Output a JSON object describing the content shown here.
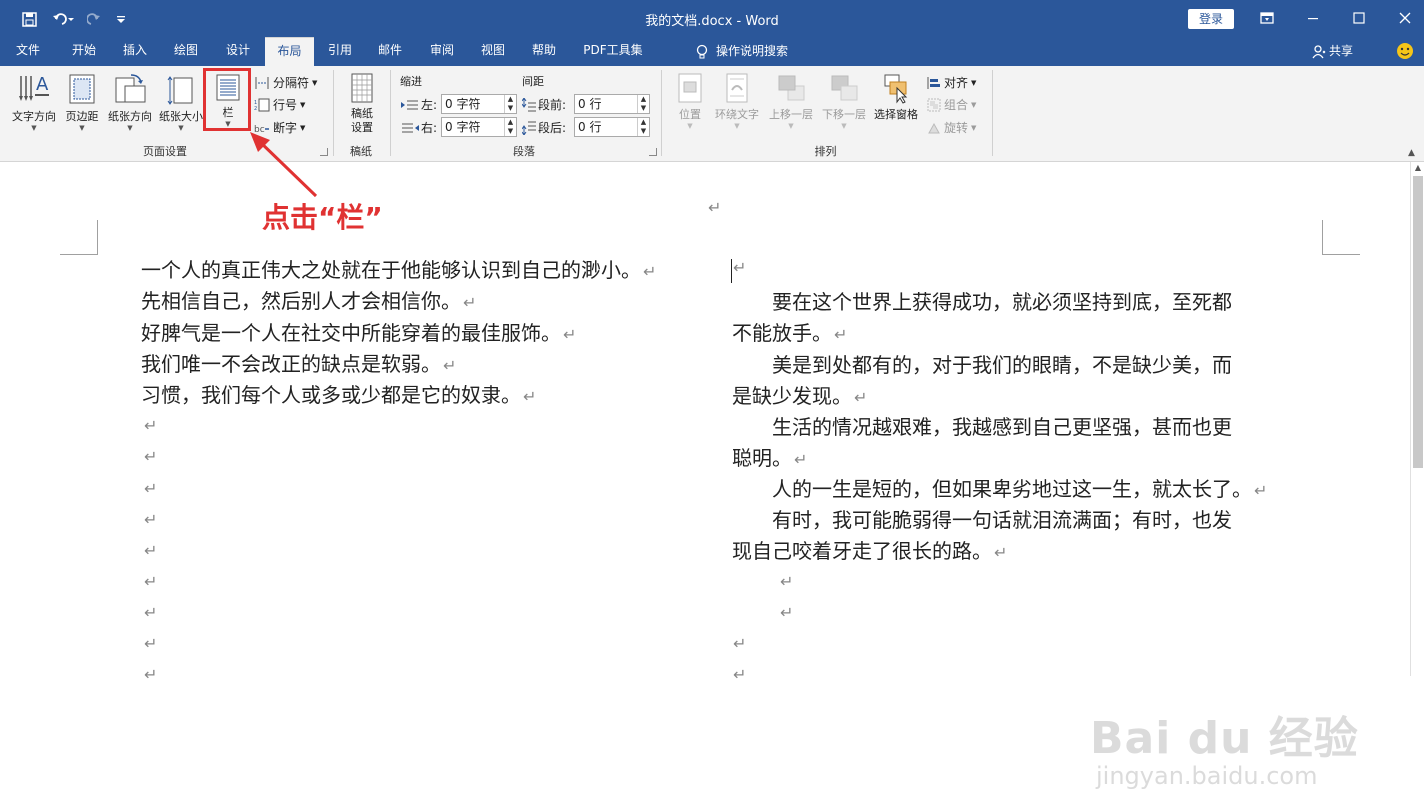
{
  "app": {
    "title": "我的文档.docx - Word",
    "login": "登录",
    "share": "共享",
    "tell_me": "操作说明搜索"
  },
  "tabs": [
    "文件",
    "开始",
    "插入",
    "绘图",
    "设计",
    "布局",
    "引用",
    "邮件",
    "审阅",
    "视图",
    "帮助",
    "PDF工具集"
  ],
  "active_tab": "布局",
  "ribbon": {
    "page_setup": {
      "label": "页面设置",
      "text_direction": "文字方向",
      "margins": "页边距",
      "orientation": "纸张方向",
      "size": "纸张大小",
      "columns": "栏",
      "breaks": "分隔符",
      "line_numbers": "行号",
      "hyphenation": "断字"
    },
    "manuscript": {
      "label": "稿纸",
      "setup_line1": "稿纸",
      "setup_line2": "设置"
    },
    "paragraph": {
      "label": "段落",
      "indent": "缩进",
      "spacing": "间距",
      "left_label": "左:",
      "right_label": "右:",
      "left_value": "0 字符",
      "right_value": "0 字符",
      "before_label": "段前:",
      "after_label": "段后:",
      "before_value": "0 行",
      "after_value": "0 行"
    },
    "arrange": {
      "label": "排列",
      "position": "位置",
      "wrap_text": "环绕文字",
      "bring_forward": "上移一层",
      "send_backward": "下移一层",
      "selection_pane": "选择窗格",
      "align": "对齐",
      "group": "组合",
      "rotate": "旋转"
    }
  },
  "annotation": "点击“栏”",
  "document": {
    "left_column": [
      "一个人的真正伟大之处就在于他能够认识到自己的渺小。",
      "先相信自己，然后别人才会相信你。",
      "好脾气是一个人在社交中所能穿着的最佳服饰。",
      "我们唯一不会改正的缺点是软弱。",
      "习惯，我们每个人或多或少都是它的奴隶。"
    ],
    "right_column": [
      "　　要在这个世界上获得成功，就必须坚持到底，至死都",
      "不能放手。",
      "　　美是到处都有的，对于我们的眼睛，不是缺少美，而",
      "是缺少发现。",
      "　　生活的情况越艰难，我越感到自己更坚强，甚而也更",
      "聪明。",
      "　　人的一生是短的，但如果卑劣地过这一生，就太长了。",
      "　　有时，我可能脆弱得一句话就泪流满面；有时，也发",
      "现自己咬着牙走了很长的路。"
    ],
    "paragraph_mark": "↵"
  },
  "watermark": {
    "logo": "Bai du 经验",
    "url": "jingyan.baidu.com"
  },
  "colors": {
    "title_bar": "#2b579a",
    "annotation": "#e03232",
    "ribbon": "#f3f3f3"
  }
}
